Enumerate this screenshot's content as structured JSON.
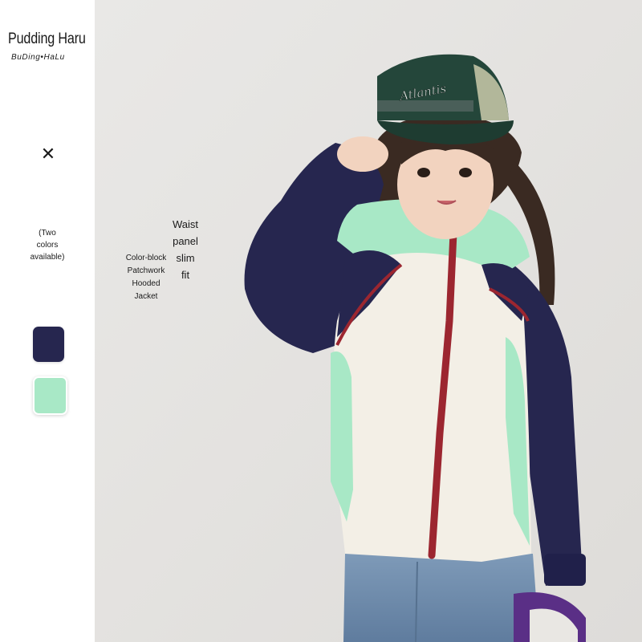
{
  "brand": {
    "name": "Pudding Haru",
    "subtitle": "BuDing•HaLu"
  },
  "close_icon": "close-x-icon",
  "colors_note": [
    "(Two",
    "colors",
    "available)"
  ],
  "swatches": [
    {
      "name": "navy",
      "color": "#26264f"
    },
    {
      "name": "mint",
      "color": "#a8e8c6"
    }
  ],
  "product_name_lines": [
    "Color-block",
    "Patchwork",
    "Hooded",
    "Jacket"
  ],
  "fit_lines": [
    "Waist",
    "panel",
    "slim",
    "fit"
  ],
  "cap_text": "Atlantis"
}
